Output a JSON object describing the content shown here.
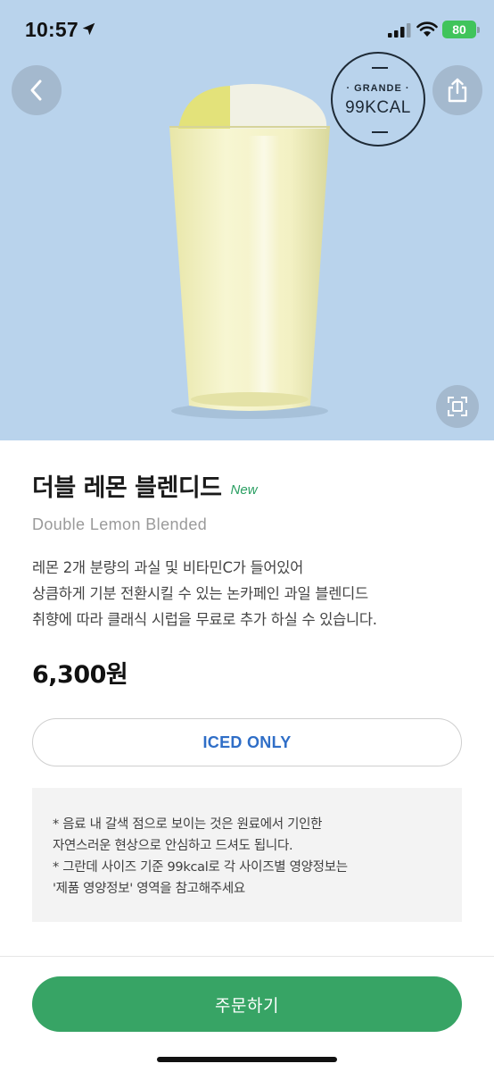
{
  "status_bar": {
    "time": "10:57",
    "battery": "80"
  },
  "hero": {
    "background_color": "#b9d3ec",
    "size_badge": {
      "size": "· GRANDE ·",
      "kcal": "99KCAL"
    },
    "icons": {
      "back": "chevron-left-icon",
      "share": "share-icon",
      "scan": "scan-icon",
      "location": "location-arrow-icon"
    }
  },
  "product": {
    "name_ko": "더블 레몬 블렌디드",
    "new_tag": "New",
    "name_en": "Double Lemon Blended",
    "description": [
      "레몬 2개 분량의 과실 및 비타민C가 들어있어",
      "상큼하게 기분 전환시킬 수 있는 논카페인 과일 블렌디드",
      "취향에 따라 클래식 시럽을 무료로 추가 하실 수 있습니다."
    ],
    "price": "6,300원"
  },
  "option_button": {
    "label": "ICED ONLY"
  },
  "notice": {
    "lines": [
      "* 음료 내 갈색 점으로 보이는 것은 원료에서 기인한",
      "자연스러운 현상으로 안심하고 드셔도 됩니다.",
      "* 그란데 사이즈 기준 99kcal로 각 사이즈별 영양정보는",
      "'제품 영양정보' 영역을 참고해주세요"
    ]
  },
  "order_button": {
    "label": "주문하기"
  },
  "colors": {
    "accent_green": "#37a465",
    "new_green": "#2a9f62",
    "iced_blue": "#2f6ec7"
  }
}
